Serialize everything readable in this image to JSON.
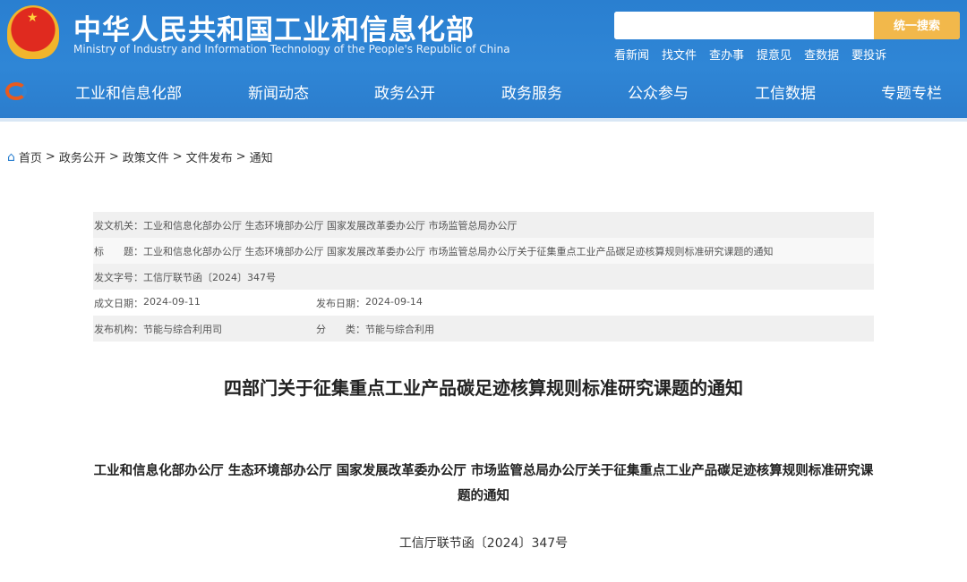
{
  "header": {
    "title_cn": "中华人民共和国工业和信息化部",
    "title_en": "Ministry of Industry and Information Technology of the People's Republic of China",
    "search_placeholder": "",
    "search_button": "统一搜索",
    "quick_links": [
      "看新闻",
      "找文件",
      "查办事",
      "提意见",
      "查数据",
      "要投诉"
    ]
  },
  "nav": [
    "工业和信息化部",
    "新闻动态",
    "政务公开",
    "政务服务",
    "公众参与",
    "工信数据",
    "专题专栏"
  ],
  "breadcrumb": [
    "首页",
    "政务公开",
    "政策文件",
    "文件发布",
    "通知"
  ],
  "meta": {
    "issuer_label": "发文机关：",
    "issuer": "工业和信息化部办公厅 生态环境部办公厅 国家发展改革委办公厅 市场监管总局办公厅",
    "title_label": "标　　题：",
    "title": "工业和信息化部办公厅 生态环境部办公厅 国家发展改革委办公厅 市场监管总局办公厅关于征集重点工业产品碳足迹核算规则标准研究课题的通知",
    "docno_label": "发文字号：",
    "docno": "工信厅联节函〔2024〕347号",
    "written_label": "成文日期：",
    "written": "2024-09-11",
    "published_label": "发布日期：",
    "published": "2024-09-14",
    "org_label": "发布机构：",
    "org": "节能与综合利用司",
    "category_label": "分　　类：",
    "category": "节能与综合利用"
  },
  "document": {
    "title": "四部门关于征集重点工业产品碳足迹核算规则标准研究课题的通知",
    "subtitle": "工业和信息化部办公厅  生态环境部办公厅  国家发展改革委办公厅  市场监管总局办公厅关于征集重点工业产品碳足迹核算规则标准研究课题的通知",
    "docno": "工信厅联节函〔2024〕347号"
  }
}
